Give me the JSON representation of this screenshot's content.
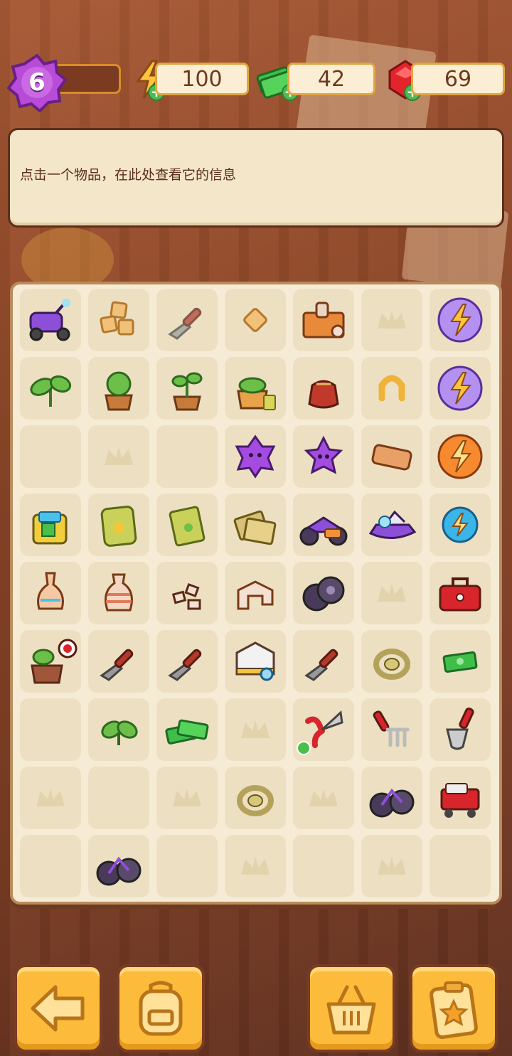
{
  "hud": {
    "level": "6",
    "energy": "100",
    "cash": "42",
    "gems": "69"
  },
  "info_panel": {
    "hint": "点击一个物品，在此处查看它的信息"
  },
  "board": {
    "rows": 9,
    "cols": 7,
    "cells": [
      [
        "purple-scooter",
        "wood-blocks",
        "trowel-ghost",
        "small-block",
        "antique-crate",
        "empty-crown",
        "energy-orb-purple"
      ],
      [
        "sprout",
        "potted-plant",
        "potted-sapling",
        "potted-plant-seeds",
        "pouch",
        "horseshoe",
        "energy-orb-purple"
      ],
      [
        "empty",
        "empty-crown",
        "empty",
        "purple-star-blob",
        "purple-star",
        "leather-wallet",
        "energy-orb-orange"
      ],
      [
        "water-crate",
        "seed-bag",
        "seed-packet",
        "seed-packets-stack",
        "motorbike",
        "jet-ski",
        "energy-orb-blue"
      ],
      [
        "vase-tall",
        "vase-striped",
        "rubble",
        "broken-blocks",
        "wheels",
        "empty-crown",
        "toolbox"
      ],
      [
        "planter-pot",
        "trowel",
        "trowel",
        "evidence-box",
        "trowel",
        "rope-coil",
        "cash-small"
      ],
      [
        "empty",
        "leaf",
        "cash-stack",
        "empty-crown",
        "pruning-shears",
        "garden-fork",
        "garden-shovel"
      ],
      [
        "empty-crown",
        "empty",
        "empty-crown",
        "rope-coil",
        "empty-crown",
        "bicycle",
        "tool-cart"
      ],
      [
        "empty",
        "bicycle",
        "empty",
        "empty-crown",
        "empty",
        "empty-crown",
        "empty"
      ]
    ]
  },
  "toolbar": {
    "back": "back-arrow-icon",
    "backpack": "backpack-icon",
    "shop": "basket-icon",
    "tasks": "clipboard-star-icon"
  }
}
